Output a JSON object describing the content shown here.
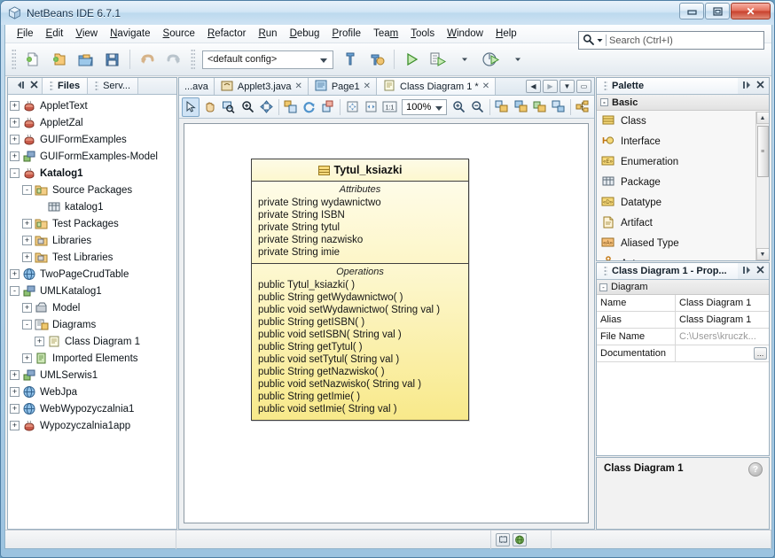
{
  "window": {
    "title": "NetBeans IDE 6.7.1",
    "app_icon": "netbeans-cube-icon",
    "minimize": "–",
    "maximize": "▣",
    "close": "✕"
  },
  "menubar": {
    "items": [
      {
        "label": "File",
        "mnemonic": "F"
      },
      {
        "label": "Edit",
        "mnemonic": "E"
      },
      {
        "label": "View",
        "mnemonic": "V"
      },
      {
        "label": "Navigate",
        "mnemonic": "N"
      },
      {
        "label": "Source",
        "mnemonic": "S"
      },
      {
        "label": "Refactor",
        "mnemonic": "R"
      },
      {
        "label": "Run",
        "mnemonic": "R"
      },
      {
        "label": "Debug",
        "mnemonic": "D"
      },
      {
        "label": "Profile",
        "mnemonic": "P"
      },
      {
        "label": "Team",
        "mnemonic": "m"
      },
      {
        "label": "Tools",
        "mnemonic": "T"
      },
      {
        "label": "Window",
        "mnemonic": "W"
      },
      {
        "label": "Help",
        "mnemonic": "H"
      }
    ]
  },
  "toolbar": {
    "buttons": [
      "new-file-icon",
      "new-project-icon",
      "open-project-icon",
      "save-all-icon",
      "undo-icon",
      "redo-icon"
    ],
    "config_value": "<default config>",
    "build_icon": "build-project-icon",
    "clean-build_icon": "clean-build-project-icon",
    "run_icon": "run-project-icon",
    "debug_icon": "debug-project-icon",
    "profile_icon": "profile-project-icon",
    "search_placeholder": "Search (Ctrl+I)",
    "search_value": "",
    "search_icon": "search-icon"
  },
  "left_panel": {
    "tabs": [
      {
        "label": "Files",
        "active": true
      },
      {
        "label": "Serv...",
        "active": false
      }
    ],
    "minimize_icon": "minimize-window-icon",
    "close_icon": "close-icon",
    "tree": [
      {
        "label": "AppletText",
        "indent": 0,
        "expander": "+",
        "icon": "java-project-icon",
        "bold": false
      },
      {
        "label": "AppletZal",
        "indent": 0,
        "expander": "+",
        "icon": "java-project-icon",
        "bold": false
      },
      {
        "label": "GUIFormExamples",
        "indent": 0,
        "expander": "+",
        "icon": "java-project-icon",
        "bold": false
      },
      {
        "label": "GUIFormExamples-Model",
        "indent": 0,
        "expander": "+",
        "icon": "uml-project-icon",
        "bold": false
      },
      {
        "label": "Katalog1",
        "indent": 0,
        "expander": "-",
        "icon": "java-project-icon",
        "bold": true
      },
      {
        "label": "Source Packages",
        "indent": 1,
        "expander": "-",
        "icon": "source-folder-icon",
        "bold": false
      },
      {
        "label": "katalog1",
        "indent": 2,
        "expander": "",
        "icon": "package-icon",
        "bold": false
      },
      {
        "label": "Test Packages",
        "indent": 1,
        "expander": "+",
        "icon": "source-folder-icon",
        "bold": false
      },
      {
        "label": "Libraries",
        "indent": 1,
        "expander": "+",
        "icon": "libraries-icon",
        "bold": false
      },
      {
        "label": "Test Libraries",
        "indent": 1,
        "expander": "+",
        "icon": "libraries-icon",
        "bold": false
      },
      {
        "label": "TwoPageCrudTable",
        "indent": 0,
        "expander": "+",
        "icon": "web-project-icon",
        "bold": false
      },
      {
        "label": "UMLKatalog1",
        "indent": 0,
        "expander": "-",
        "icon": "uml-project-icon",
        "bold": false
      },
      {
        "label": "Model",
        "indent": 1,
        "expander": "+",
        "icon": "model-icon",
        "bold": false
      },
      {
        "label": "Diagrams",
        "indent": 1,
        "expander": "-",
        "icon": "diagrams-icon",
        "bold": false
      },
      {
        "label": "Class Diagram 1",
        "indent": 2,
        "expander": "+",
        "icon": "class-diagram-icon",
        "bold": false
      },
      {
        "label": "Imported Elements",
        "indent": 1,
        "expander": "+",
        "icon": "imported-elements-icon",
        "bold": false
      },
      {
        "label": "UMLSerwis1",
        "indent": 0,
        "expander": "+",
        "icon": "uml-project-icon",
        "bold": false
      },
      {
        "label": "WebJpa",
        "indent": 0,
        "expander": "+",
        "icon": "web-project-icon",
        "bold": false
      },
      {
        "label": "WebWypozyczalnia1",
        "indent": 0,
        "expander": "+",
        "icon": "web-project-icon",
        "bold": false
      },
      {
        "label": "Wypozyczalnia1app",
        "indent": 0,
        "expander": "+",
        "icon": "java-project-icon",
        "bold": false
      }
    ]
  },
  "editor": {
    "tabs": [
      {
        "label": "...ava",
        "icon": "",
        "closable": false,
        "active": false
      },
      {
        "label": "Applet3.java",
        "icon": "applet-icon",
        "closable": true,
        "active": false
      },
      {
        "label": "Page1",
        "icon": "page-icon",
        "closable": true,
        "active": false
      },
      {
        "label": "Class Diagram 1 *",
        "icon": "class-diagram-icon",
        "closable": true,
        "active": true
      }
    ],
    "nav_buttons": [
      "scroll-left-icon",
      "scroll-right-icon",
      "tab-list-icon",
      "maximize-icon"
    ],
    "toolbar_buttons": [
      "select-tool-icon",
      "pan-tool-icon",
      "zoom-region-icon",
      "zoom-in-tool-icon",
      "fit-diagram-icon",
      "align-icon",
      "refresh-layout-icon",
      "layout-icon",
      "fit-to-window-icon",
      "fit-width-icon",
      "actual-size-icon"
    ],
    "zoom_value": "100%",
    "zoom_in_icon": "zoom-in-icon",
    "zoom_out_icon": "zoom-out-icon",
    "extra_buttons": [
      "diagram-tool-1-icon",
      "diagram-tool-2-icon",
      "diagram-tool-3-icon",
      "diagram-tool-4-icon",
      "diagram-tool-5-icon"
    ]
  },
  "uml_class": {
    "name": "Tytul_ksiazki",
    "icon": "class-icon",
    "attributes_title": "Attributes",
    "attributes": [
      "private String wydawnictwo",
      "private String ISBN",
      "private String tytul",
      "private String nazwisko",
      "private String imie"
    ],
    "operations_title": "Operations",
    "operations": [
      "public Tytul_ksiazki( )",
      "public String  getWydawnictwo( )",
      "public void  setWydawnictwo( String val )",
      "public String  getISBN( )",
      "public void  setISBN( String val )",
      "public String  getTytul( )",
      "public void  setTytul( String val )",
      "public String  getNazwisko( )",
      "public void  setNazwisko( String val )",
      "public String  getImie( )",
      "public void  setImie( String val )"
    ]
  },
  "palette": {
    "title": "Palette",
    "float_icon": "float-window-icon",
    "close_icon": "close-icon",
    "category": "Basic",
    "category_expander": "-",
    "items": [
      {
        "label": "Class",
        "icon": "class-icon"
      },
      {
        "label": "Interface",
        "icon": "interface-icon"
      },
      {
        "label": "Enumeration",
        "icon": "enumeration-icon"
      },
      {
        "label": "Package",
        "icon": "package-icon"
      },
      {
        "label": "Datatype",
        "icon": "datatype-icon"
      },
      {
        "label": "Artifact",
        "icon": "artifact-icon"
      },
      {
        "label": "Aliased Type",
        "icon": "aliased-type-icon"
      },
      {
        "label": "Actor",
        "icon": "actor-icon"
      }
    ],
    "scroll_up": "▲",
    "scroll_down": "▼"
  },
  "properties": {
    "title": "Class Diagram 1 - Prop...",
    "float_icon": "float-window-icon",
    "close_icon": "close-icon",
    "category": "Diagram",
    "category_expander": "-",
    "rows": [
      {
        "key": "Name",
        "value": "Class Diagram 1",
        "dim": false,
        "button": ""
      },
      {
        "key": "Alias",
        "value": "Class Diagram 1",
        "dim": false,
        "button": ""
      },
      {
        "key": "File Name",
        "value": "C:\\Users\\kruczk...",
        "dim": true,
        "button": ""
      },
      {
        "key": "Documentation",
        "value": "",
        "dim": false,
        "button": "..."
      }
    ]
  },
  "description": {
    "title": "Class Diagram 1",
    "help_icon": "help-icon"
  },
  "statusbar": {
    "buttons": [
      "memory-icon",
      "notifications-icon"
    ]
  },
  "colors": {
    "uml_fill": "#fdf6c8",
    "uml_operations_fill": "#f8e98a",
    "uml_border": "#3f3f3f",
    "accent": "#4f7fa5"
  }
}
